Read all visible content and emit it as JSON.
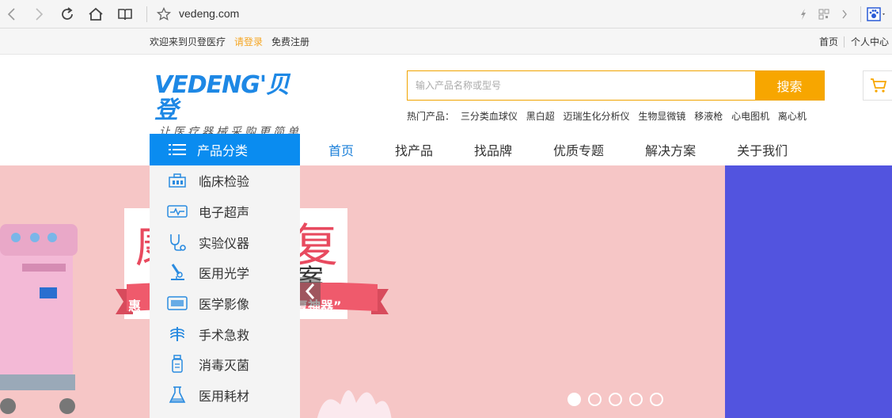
{
  "browser": {
    "url": "vedeng.com"
  },
  "topbar": {
    "welcome": "欢迎来到贝登医疗",
    "login": "请登录",
    "register": "免费注册",
    "home": "首页",
    "personal_center": "个人中心"
  },
  "header": {
    "logo_brand": "VEDENG'贝登",
    "logo_slogan": "让医疗器械采购更简单",
    "search_placeholder": "输入产品名称或型号",
    "search_button": "搜索",
    "hot_label": "热门产品：",
    "hot_items": [
      "三分类血球仪",
      "黑白超",
      "迈瑞生化分析仪",
      "生物显微镜",
      "移液枪",
      "心电图机",
      "离心机"
    ]
  },
  "nav": {
    "category_title": "产品分类",
    "items": [
      "首页",
      "找产品",
      "找品牌",
      "优质专题",
      "解决方案",
      "关于我们"
    ]
  },
  "categories": [
    {
      "label": "临床检验",
      "icon": "lab-building-icon"
    },
    {
      "label": "电子超声",
      "icon": "monitor-icon"
    },
    {
      "label": "实验仪器",
      "icon": "stethoscope-icon"
    },
    {
      "label": "医用光学",
      "icon": "microscope-icon"
    },
    {
      "label": "医学影像",
      "icon": "imaging-icon"
    },
    {
      "label": "手术急救",
      "icon": "xray-chest-icon"
    },
    {
      "label": "消毒灭菌",
      "icon": "bottle-icon"
    },
    {
      "label": "医用耗材",
      "icon": "flask-icon"
    }
  ],
  "banner": {
    "char_left": "康",
    "char_right": "复",
    "char_mid": "案",
    "ribbon_left": "惠",
    "ribbon_right": "复神器”",
    "slide_count": 5,
    "active_slide": 1
  },
  "colors": {
    "brand_blue": "#0a8cf0",
    "accent_orange": "#f7a600",
    "banner_pink": "#f6c6c6",
    "banner_purple": "#5254df"
  }
}
